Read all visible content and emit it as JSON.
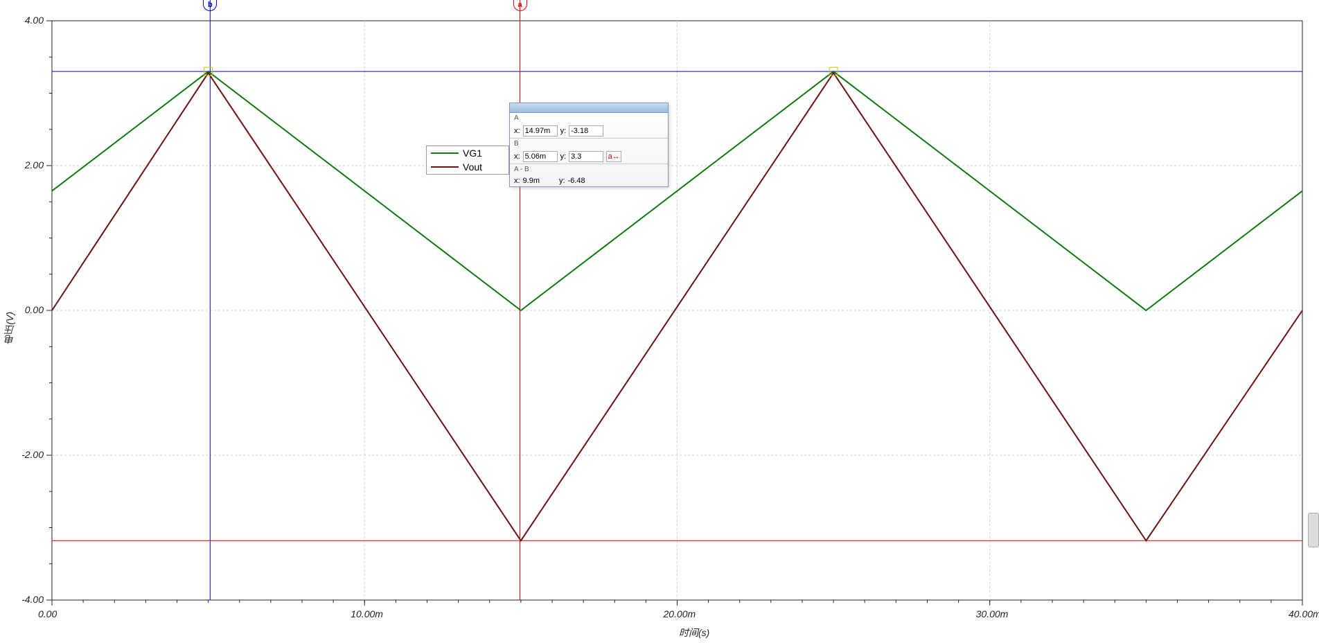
{
  "chart_data": {
    "type": "line",
    "xlabel": "时间(s)",
    "ylabel": "电压(V)",
    "xlim": [
      0,
      40
    ],
    "ylim": [
      -4,
      4
    ],
    "x_unit_suffix": "m",
    "x_ticks": [
      "0.00",
      "10.00m",
      "20.00m",
      "30.00m",
      "40.00m"
    ],
    "y_ticks": [
      "4.00",
      "2.00",
      "0.00",
      "-2.00",
      "-4.00"
    ],
    "series": [
      {
        "name": "VG1",
        "color": "#0c7a0c",
        "points": [
          [
            0.0,
            1.65
          ],
          [
            5.0,
            3.3
          ],
          [
            15.0,
            0.0
          ],
          [
            25.0,
            3.3
          ],
          [
            35.0,
            0.0
          ],
          [
            40.0,
            1.65
          ]
        ]
      },
      {
        "name": "Vout",
        "color": "#6b1010",
        "points": [
          [
            0.0,
            0.0
          ],
          [
            5.0,
            3.28
          ],
          [
            15.0,
            -3.18
          ],
          [
            25.0,
            3.28
          ],
          [
            35.0,
            -3.18
          ],
          [
            40.0,
            0.0
          ]
        ]
      }
    ],
    "cursors": {
      "a": {
        "axis": "vertical",
        "x": 14.97,
        "color": "#d00000",
        "horiz_y": -3.18
      },
      "b": {
        "axis": "vertical",
        "x": 5.06,
        "color": "#0000d0",
        "horiz_y": 3.3
      }
    }
  },
  "legend": {
    "items": [
      {
        "name": "VG1",
        "color": "#0c7a0c"
      },
      {
        "name": "Vout",
        "color": "#6b1010"
      }
    ]
  },
  "cursor_panel": {
    "A": {
      "x": "14.97m",
      "y": "-3.18"
    },
    "B": {
      "x": "5.06m",
      "y": "3.3"
    },
    "diff_label": "A - B",
    "diff": {
      "x": "9.9m",
      "y": "-6.48"
    },
    "target_label": "a↔"
  },
  "markers": {
    "a": "a",
    "b": "b"
  }
}
